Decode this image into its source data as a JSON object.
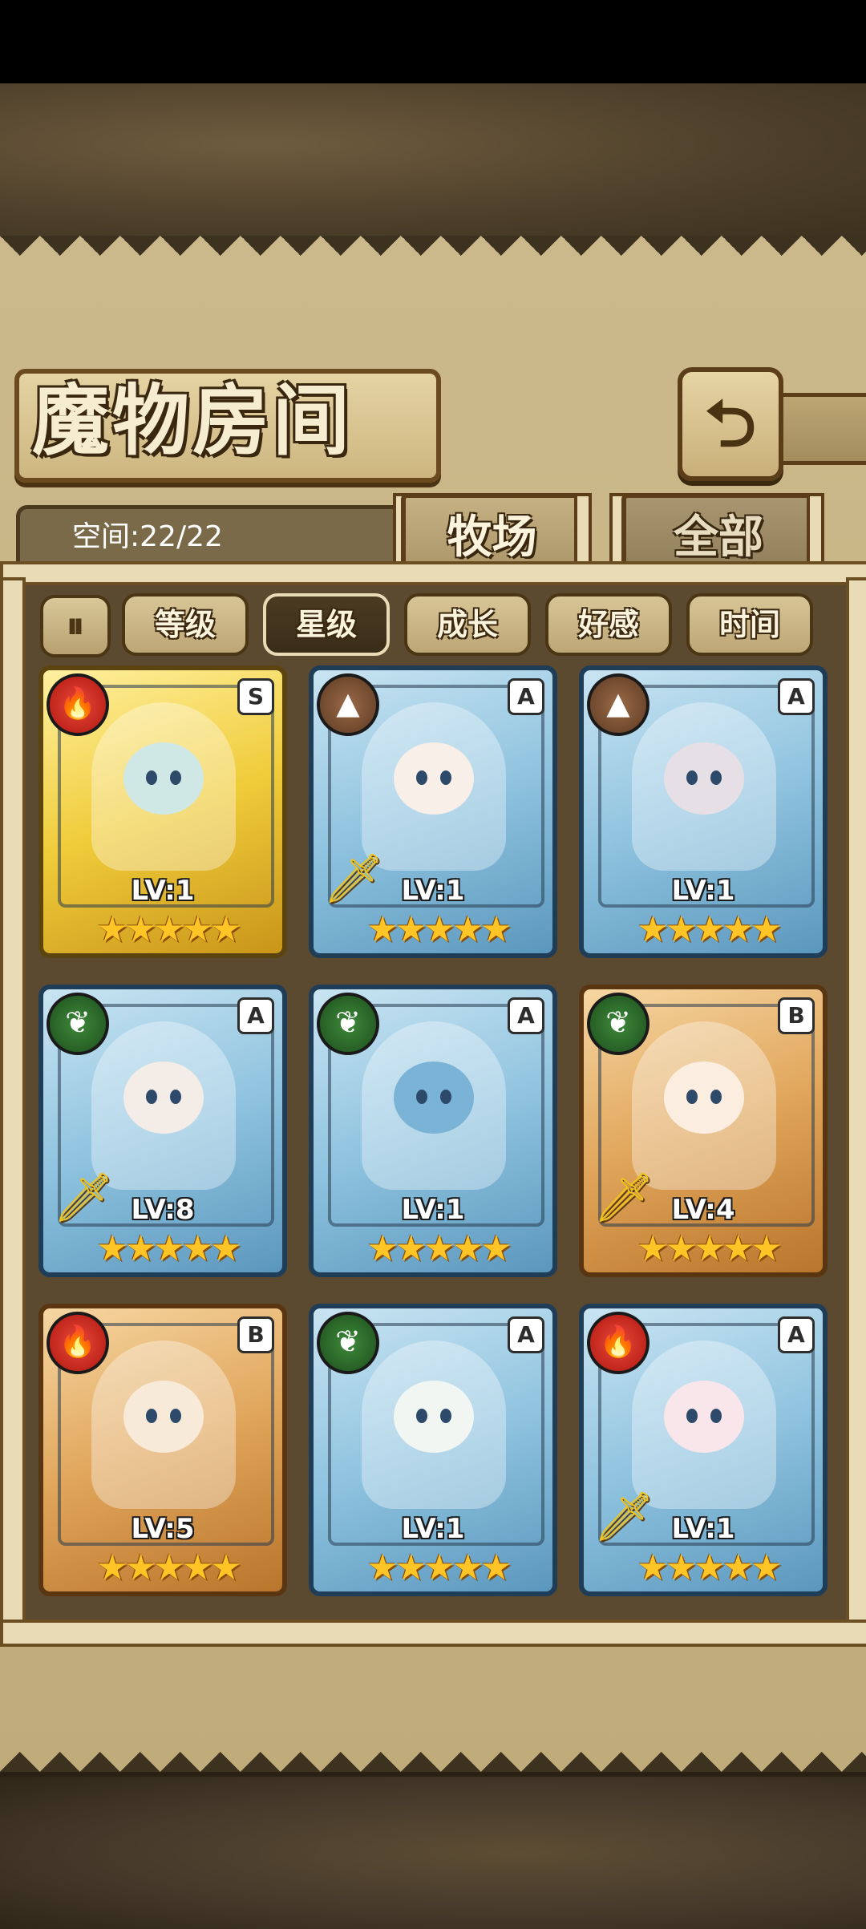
{
  "title": "魔物房间",
  "back_icon": "return-arrow-icon",
  "space": {
    "label": "空间:22/22"
  },
  "tabs": [
    {
      "label": "牧场",
      "active": true
    },
    {
      "label": "全部",
      "active": false
    }
  ],
  "sort_toggle_icon": "sort-toggle-icon",
  "filters": [
    {
      "label": "等级",
      "active": false
    },
    {
      "label": "星级",
      "active": true
    },
    {
      "label": "成长",
      "active": false
    },
    {
      "label": "好感",
      "active": false
    },
    {
      "label": "时间",
      "active": false
    }
  ],
  "monsters": [
    {
      "element": "fire",
      "rank": "S",
      "level": "LV:1",
      "stars": "★★★★★",
      "weapon": false
    },
    {
      "element": "earth",
      "rank": "A",
      "level": "LV:1",
      "stars": "★★★★★",
      "weapon": true
    },
    {
      "element": "earth",
      "rank": "A",
      "level": "LV:1",
      "stars": "★★★★★",
      "weapon": false
    },
    {
      "element": "wood",
      "rank": "A",
      "level": "LV:8",
      "stars": "★★★★★",
      "weapon": true
    },
    {
      "element": "wood",
      "rank": "A",
      "level": "LV:1",
      "stars": "★★★★★",
      "weapon": false
    },
    {
      "element": "wood",
      "rank": "B",
      "level": "LV:4",
      "stars": "★★★★★",
      "weapon": true
    },
    {
      "element": "fire",
      "rank": "B",
      "level": "LV:5",
      "stars": "★★★★★",
      "weapon": false
    },
    {
      "element": "wood",
      "rank": "A",
      "level": "LV:1",
      "stars": "★★★★★",
      "weapon": false
    },
    {
      "element": "fire",
      "rank": "A",
      "level": "LV:1",
      "stars": "★★★★★",
      "weapon": true
    }
  ],
  "colors": {
    "card_A": "#8fc3df",
    "card_S": "#f0cc3a",
    "card_B": "#e0a55a",
    "star": "#ffc526"
  }
}
